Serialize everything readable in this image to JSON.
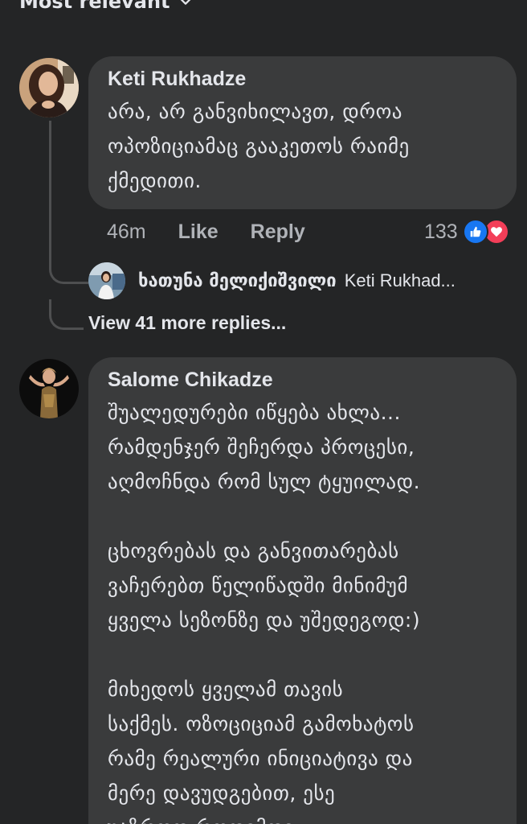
{
  "sort": {
    "label": "Most relevant",
    "icon": "chevron-down-icon"
  },
  "comments": [
    {
      "author": "Keti Rukhadze",
      "paragraphs": [
        [
          "არა, არ განვიხილავთ, დროა",
          "ოპოზიციამაც გააკეთოს რაიმე",
          "ქმედითი."
        ]
      ],
      "time": "46m",
      "like_label": "Like",
      "reply_label": "Reply",
      "reaction_count": "133",
      "reactions": [
        "like-reaction-icon",
        "love-reaction-icon"
      ],
      "replies_preview": {
        "author": "ხათუნა მელიქიშვილი",
        "text": "Keti Rukhad..."
      },
      "more_replies_label": "View 41 more replies..."
    },
    {
      "author": "Salome Chikadze",
      "paragraphs": [
        [
          "შუალედურები იწყება ახლა...",
          "რამდენჯერ შეჩერდა პროცესი,",
          "აღმოჩნდა რომ სულ ტყუილად."
        ],
        [
          "ცხოვრებას და განვითარებას",
          "ვაჩერებთ წელიწადში მინიმუმ",
          "ყველა სეზონზე და უშედეგოდ:)"
        ],
        [
          "მიხედოს ყველამ თავის",
          "საქმეს. ოზოციციამ გამოხატოს",
          "რამე რეალური ინიციატივა და",
          "მერე დავუდგებით, ესე",
          "უაზროდ როდემდე"
        ]
      ]
    }
  ],
  "colors": {
    "background": "#242526",
    "bubble": "#3a3b3c",
    "text": "#e4e6eb",
    "secondary_text": "#b0b3b8",
    "like_blue": "#1877f2",
    "love_red": "#f33e58"
  }
}
